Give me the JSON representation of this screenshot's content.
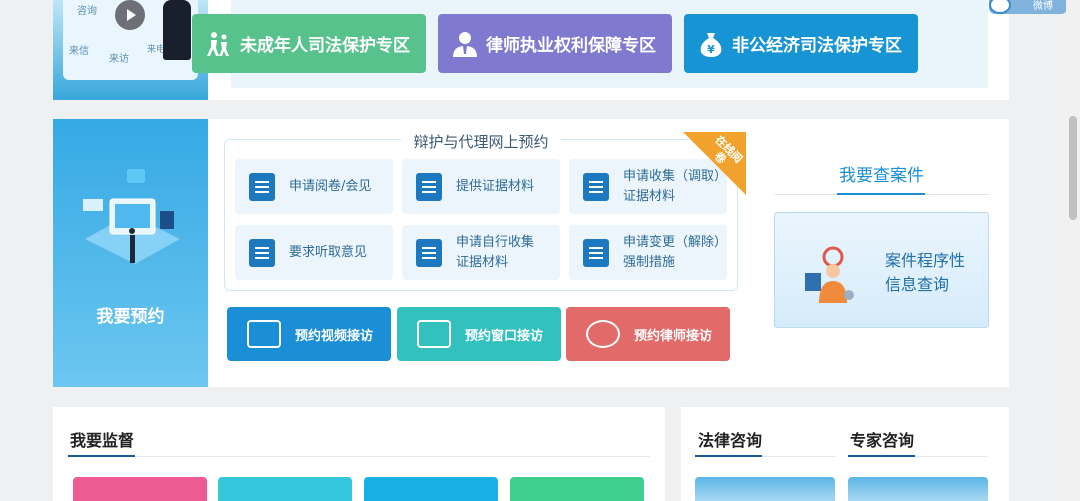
{
  "top": {
    "promo_words": [
      "来信",
      "来访",
      "来电",
      "咨询"
    ],
    "zones": [
      {
        "label": "未成年人司法保护专区",
        "icon": "children-icon",
        "color": "#58c28c"
      },
      {
        "label": "律师执业权利保障专区",
        "icon": "lawyer-icon",
        "color": "#7f7ad0"
      },
      {
        "label": "非公经济司法保护专区",
        "icon": "money-bag-icon",
        "color": "#1694d3"
      }
    ],
    "float_badge": "微博"
  },
  "reservation": {
    "side_caption": "我要预约",
    "section_title": "辩护与代理网上预约",
    "ribbon": "在线阅卷",
    "services": [
      {
        "line1": "申请阅卷/会见",
        "line2": ""
      },
      {
        "line1": "提供证据材料",
        "line2": ""
      },
      {
        "line1": "申请收集（调取）",
        "line2": "证据材料"
      },
      {
        "line1": "要求听取意见",
        "line2": ""
      },
      {
        "line1": "申请自行收集",
        "line2": "证据材料"
      },
      {
        "line1": "申请变更（解除）",
        "line2": "强制措施"
      }
    ],
    "actions": [
      {
        "label": "预约视频接访",
        "icon": "video-camera-icon"
      },
      {
        "label": "预约窗口接访",
        "icon": "window-reception-icon"
      },
      {
        "label": "预约律师接访",
        "icon": "lawyer-reception-icon"
      }
    ],
    "case_title": "我要查案件",
    "case_card_line1": "案件程序性",
    "case_card_line2": "信息查询"
  },
  "bottom": {
    "supervise_title": "我要监督",
    "legal_consult": "法律咨询",
    "expert_consult": "专家咨询"
  },
  "colors": {
    "primary": "#1a8fd6",
    "orange": "#f0a22c",
    "red": "#e26a68",
    "teal": "#32c1bd"
  }
}
